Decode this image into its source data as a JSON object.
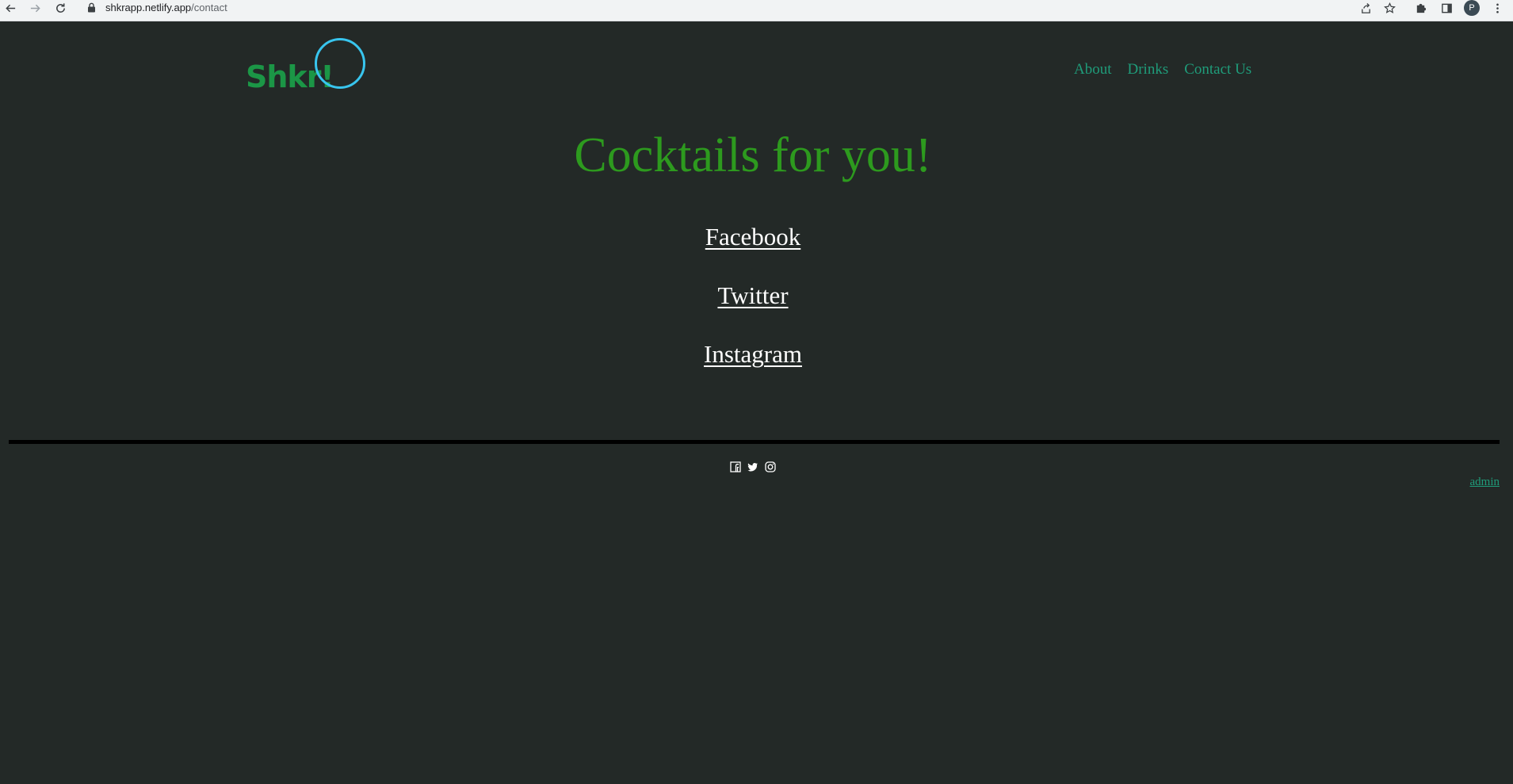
{
  "browser": {
    "url_host": "shkrapp.netlify.app",
    "url_path": "/contact",
    "profile_initial": "P"
  },
  "site": {
    "logo_text": "Shkr!",
    "nav": [
      {
        "label": "About"
      },
      {
        "label": "Drinks"
      },
      {
        "label": "Contact Us"
      }
    ]
  },
  "main": {
    "title": "Cocktails for you!",
    "social_links": [
      {
        "label": "Facebook"
      },
      {
        "label": "Twitter"
      },
      {
        "label": "Instagram"
      }
    ]
  },
  "footer": {
    "icons": [
      "facebook-icon",
      "twitter-icon",
      "instagram-icon"
    ],
    "admin_label": "admin"
  },
  "colors": {
    "background": "#232927",
    "logo": "#1b9646",
    "logo_circle": "#38c5ee",
    "nav_link": "#1f9c7a",
    "title": "#2d9a1e",
    "social_link": "#ffffff"
  }
}
